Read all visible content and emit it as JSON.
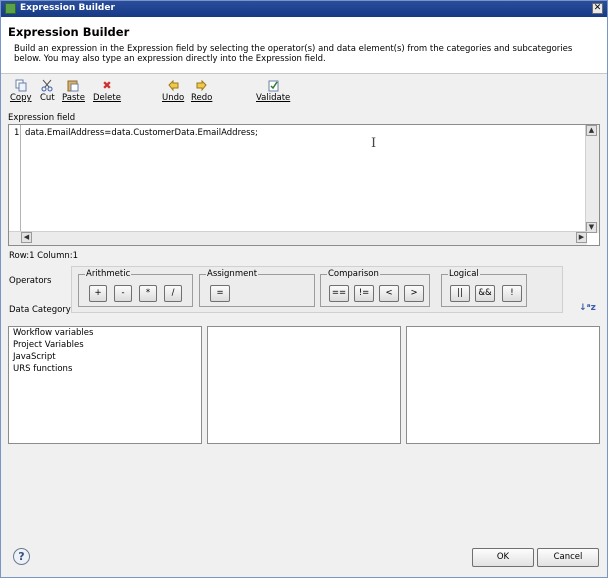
{
  "window": {
    "title": "Expression Builder",
    "close_glyph": "✕"
  },
  "header": {
    "title": "Expression Builder",
    "description": "Build an expression in the Expression field by selecting the operator(s) and data element(s) from the categories and subcategories below. You may also type an expression directly into the Expression field."
  },
  "toolbar": {
    "copy": {
      "label": "Copy",
      "icon": "copy-icon"
    },
    "cut": {
      "label": "Cut",
      "icon": "cut-icon"
    },
    "paste": {
      "label": "Paste",
      "icon": "paste-icon"
    },
    "delete": {
      "label": "Delete",
      "icon": "delete-icon"
    },
    "undo": {
      "label": "Undo",
      "icon": "undo-icon"
    },
    "redo": {
      "label": "Redo",
      "icon": "redo-icon"
    },
    "validate": {
      "label": "Validate",
      "icon": "validate-icon"
    }
  },
  "expression": {
    "label": "Expression field",
    "line_number": "1",
    "code": "data.EmailAddress=data.CustomerData.EmailAddress;",
    "status": "Row:1 Column:1"
  },
  "operators": {
    "label": "Operators",
    "groups": {
      "arithmetic": {
        "label": "Arithmetic",
        "buttons": [
          "+",
          "-",
          "*",
          "/"
        ]
      },
      "assignment": {
        "label": "Assignment",
        "buttons": [
          "="
        ]
      },
      "comparison": {
        "label": "Comparison",
        "buttons": [
          "==",
          "!=",
          "<",
          ">"
        ]
      },
      "logical": {
        "label": "Logical",
        "buttons": [
          "||",
          "&&",
          "!"
        ]
      }
    }
  },
  "data_category": {
    "label": "Data Category",
    "categories": [
      "Workflow variables",
      "Project Variables",
      "JavaScript",
      "URS functions"
    ]
  },
  "dialog": {
    "ok": "OK",
    "cancel": "Cancel",
    "help": "?"
  },
  "colors": {
    "titlebar": "#1f4591",
    "accent_delete": "#d03030"
  }
}
